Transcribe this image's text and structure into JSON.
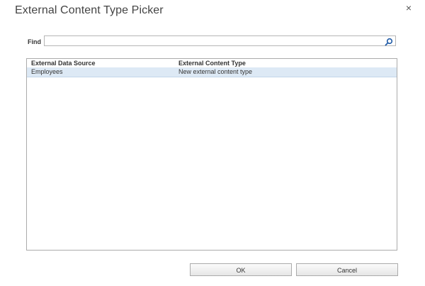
{
  "dialog": {
    "title": "External Content Type Picker",
    "close_glyph": "×"
  },
  "find": {
    "label": "Find",
    "value": "",
    "search_icon": "search-icon"
  },
  "grid": {
    "columns": [
      "External Data Source",
      "External Content Type"
    ],
    "rows": [
      {
        "source": "Employees",
        "type": "New external content type",
        "selected": true
      }
    ],
    "selected_row_color": "#dde9f5"
  },
  "buttons": {
    "ok_label": "OK",
    "cancel_label": "Cancel"
  }
}
